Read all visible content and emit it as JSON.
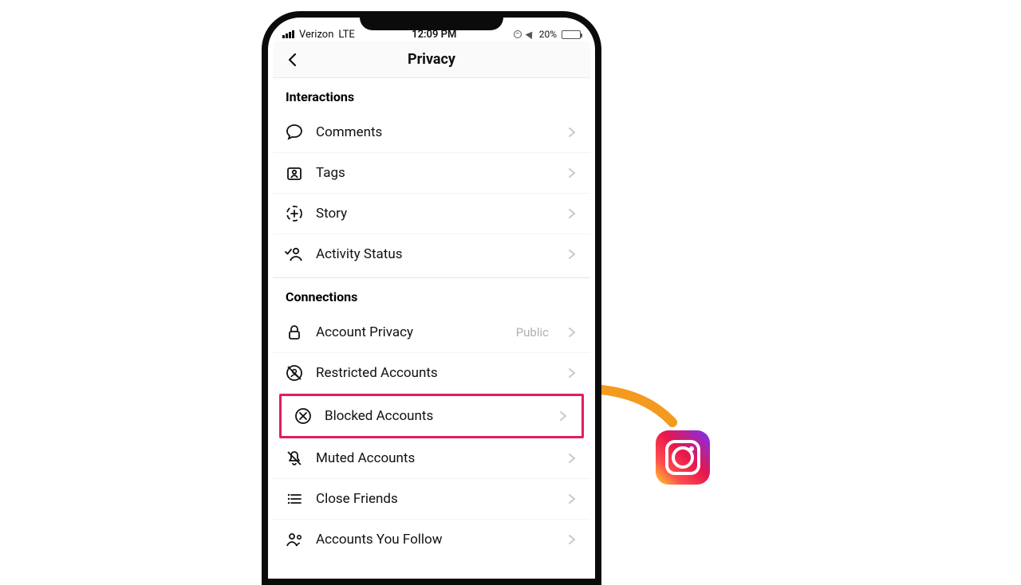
{
  "status_bar": {
    "carrier": "Verizon",
    "network": "LTE",
    "time": "12:09 PM",
    "battery_percent": "20%"
  },
  "nav": {
    "title": "Privacy"
  },
  "sections": {
    "interactions": {
      "header": "Interactions",
      "items": {
        "comments": {
          "label": "Comments"
        },
        "tags": {
          "label": "Tags"
        },
        "story": {
          "label": "Story"
        },
        "activity_status": {
          "label": "Activity Status"
        }
      }
    },
    "connections": {
      "header": "Connections",
      "items": {
        "account_privacy": {
          "label": "Account Privacy",
          "value": "Public"
        },
        "restricted": {
          "label": "Restricted Accounts"
        },
        "blocked": {
          "label": "Blocked Accounts"
        },
        "muted": {
          "label": "Muted Accounts"
        },
        "close_friends": {
          "label": "Close Friends"
        },
        "accounts_you_follow": {
          "label": "Accounts You Follow"
        }
      }
    }
  },
  "highlight_item": "blocked",
  "annotation": {
    "arrow_color": "#f39a1f"
  }
}
